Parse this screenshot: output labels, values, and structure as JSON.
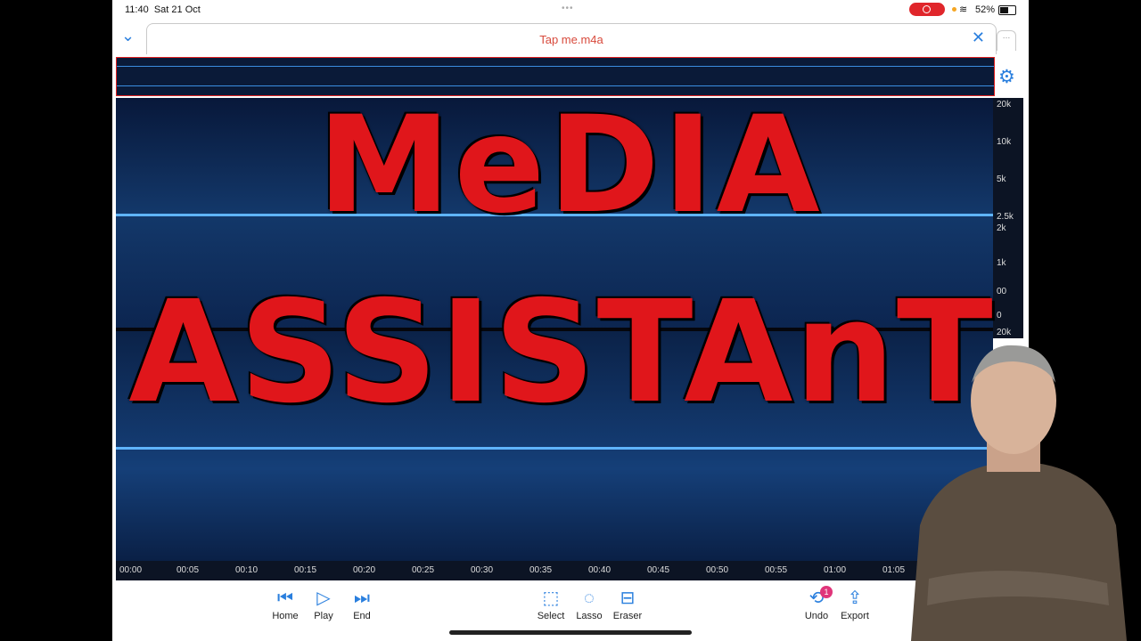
{
  "status": {
    "time": "11:40",
    "date": "Sat 21 Oct",
    "battery": "52%"
  },
  "tab": {
    "title": "Tap me.m4a"
  },
  "headline": {
    "line1": "MeDIA",
    "line2": "ASSISTAnT"
  },
  "freq_labels": [
    "20k",
    "10k",
    "5k",
    "2.5k",
    "2k",
    "1k",
    "00",
    "0",
    "20k"
  ],
  "timeline": [
    "00:00",
    "00:05",
    "00:10",
    "00:15",
    "00:20",
    "00:25",
    "00:30",
    "00:35",
    "00:40",
    "00:45",
    "00:50",
    "00:55",
    "01:00",
    "01:05"
  ],
  "toolbar": {
    "home": "Home",
    "play": "Play",
    "end": "End",
    "select": "Select",
    "lasso": "Lasso",
    "eraser": "Eraser",
    "undo": "Undo",
    "undo_badge": "1",
    "export": "Export"
  },
  "icons": {
    "home": "first-page-icon",
    "play": "play-icon",
    "end": "last-page-icon",
    "select": "select-rectangle-icon",
    "lasso": "lasso-icon",
    "eraser": "eraser-icon",
    "undo": "undo-icon",
    "export": "export-icon",
    "gear": "gear-icon"
  },
  "colors": {
    "accent": "#2a7fde",
    "tab_title": "#d84a3c",
    "headline": "#e0161b",
    "record": "#e0262b"
  }
}
